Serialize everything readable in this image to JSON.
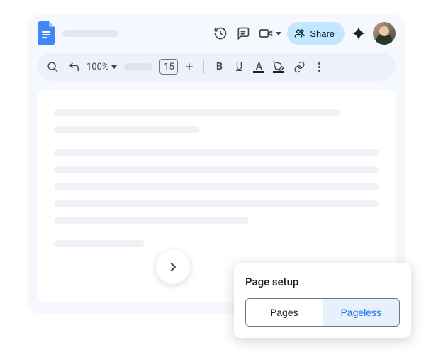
{
  "header": {
    "share_label": "Share"
  },
  "toolbar": {
    "zoom_label": "100%",
    "font_size": "15"
  },
  "page_setup": {
    "title": "Page setup",
    "option_pages": "Pages",
    "option_pageless": "Pageless"
  }
}
